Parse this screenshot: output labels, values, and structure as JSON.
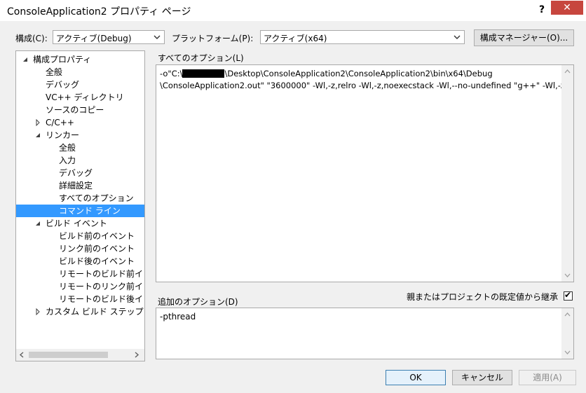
{
  "window": {
    "title": "ConsoleApplication2 プロパティ ページ",
    "help": "?",
    "close": "✕"
  },
  "toolbar": {
    "config_label": "構成(C):",
    "config_value": "アクティブ(Debug)",
    "platform_label": "プラットフォーム(P):",
    "platform_value": "アクティブ(x64)",
    "config_manager_button": "構成マネージャー(O)..."
  },
  "tree": {
    "items": [
      {
        "label": "構成プロパティ",
        "expanded": true
      },
      {
        "label": "全般"
      },
      {
        "label": "デバッグ"
      },
      {
        "label": "VC++ ディレクトリ"
      },
      {
        "label": "ソースのコピー"
      },
      {
        "label": "C/C++",
        "expanded": false
      },
      {
        "label": "リンカー",
        "expanded": true
      },
      {
        "label": "全般"
      },
      {
        "label": "入力"
      },
      {
        "label": "デバッグ"
      },
      {
        "label": "詳細設定"
      },
      {
        "label": "すべてのオプション"
      },
      {
        "label": "コマンド ライン",
        "selected": true
      },
      {
        "label": "ビルド イベント",
        "expanded": true
      },
      {
        "label": "ビルド前のイベント"
      },
      {
        "label": "リンク前のイベント"
      },
      {
        "label": "ビルド後のイベント"
      },
      {
        "label": "リモートのビルド前イ"
      },
      {
        "label": "リモートのリンク前イ"
      },
      {
        "label": "リモートのビルド後イ"
      },
      {
        "label": "カスタム ビルド ステップ",
        "expanded": false
      }
    ]
  },
  "all_options": {
    "label": "すべてのオプション(L)",
    "line1_prefix": "-o\"C:\\",
    "line1_suffix": "\\Desktop\\ConsoleApplication2\\ConsoleApplication2\\bin\\x64\\Debug",
    "line2": "\\ConsoleApplication2.out\" \"3600000\" -Wl,-z,relro -Wl,-z,noexecstack -Wl,--no-undefined \"g++\" -Wl,-z,now"
  },
  "inherit": {
    "label": "親またはプロジェクトの既定値から継承",
    "checked": true,
    "check_glyph": "✔"
  },
  "additional_options": {
    "label": "追加のオプション(D)",
    "value": "-pthread"
  },
  "footer": {
    "ok": "OK",
    "cancel": "キャンセル",
    "apply": "適用(A)"
  }
}
